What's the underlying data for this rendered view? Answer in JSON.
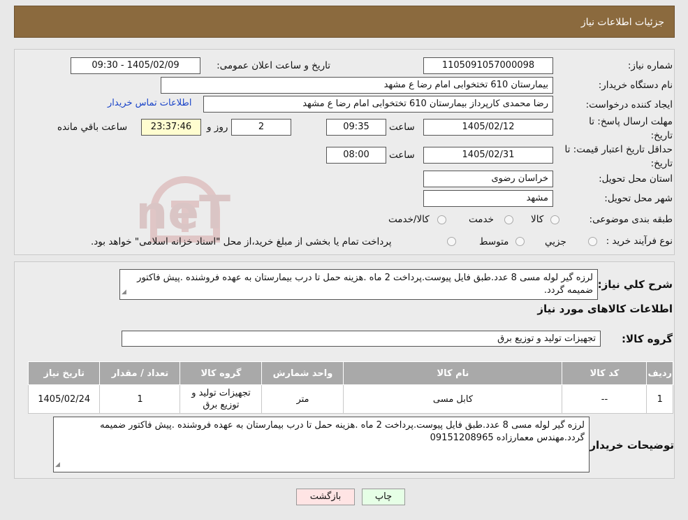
{
  "header": {
    "title": "جزئیات اطلاعات نیاز"
  },
  "form": {
    "need_number_label": "شماره نیاز:",
    "need_number": "1105091057000098",
    "announce_label": "تاریخ و ساعت اعلان عمومی:",
    "announce_value": "1405/02/09 - 09:30",
    "buyer_org_label": "نام دستگاه خریدار:",
    "buyer_org": "بیمارستان 610 تختخوابی امام رضا ع  مشهد",
    "creator_label": "ایجاد کننده درخواست:",
    "creator": "رضا محمدی کارپرداز بیمارستان 610 تختخوابی امام رضا ع  مشهد",
    "contact_link": "اطلاعات تماس خریدار",
    "reply_deadline_label": "مهلت ارسال پاسخ: تا تاریخ:",
    "reply_date": "1405/02/12",
    "time_label": "ساعت",
    "reply_time": "09:35",
    "days_value": "2",
    "days_label": "روز و",
    "remaining_time": "23:37:46",
    "remaining_label": "ساعت باقي مانده",
    "validity_label": "حداقل تاریخ اعتبار قیمت: تا تاریخ:",
    "validity_date": "1405/02/31",
    "validity_time": "08:00",
    "province_label": "استان محل تحویل:",
    "province": "خراسان رضوی",
    "city_label": "شهر محل تحویل:",
    "city": "مشهد",
    "category_label": "طبقه بندی موضوعی:",
    "category_options": [
      "کالا",
      "خدمت",
      "کالا/خدمت"
    ],
    "process_label": "نوع فرآیند خرید :",
    "process_options": [
      "جزيي",
      "متوسط"
    ],
    "process_note": "پرداخت تمام یا بخشی از مبلغ خرید،از محل \"اسناد خزانه اسلامی\" خواهد بود."
  },
  "summary": {
    "label": "شرح کلي نياز:",
    "text": "لرزه گیر لوله مسی 8 عدد.طبق فایل پیوست.پرداخت 2 ماه .هزینه حمل تا درب بیمارستان به عهده فروشنده .پیش فاکتور ضمیمه گردد."
  },
  "goods": {
    "section_title": "اطلاعات کالاهای مورد نیاز",
    "group_label": "گروه کالا:",
    "group_value": "تجهیزات تولید و توزیع برق",
    "columns": [
      "رديف",
      "کد کالا",
      "نام کالا",
      "واحد شمارش",
      "گروه کالا",
      "تعداد / مقدار",
      "تاریخ نیاز"
    ],
    "rows": [
      {
        "row": "1",
        "code": "--",
        "name": "کابل مسی",
        "unit": "متر",
        "group": "تجهیزات تولید و توزیع برق",
        "qty": "1",
        "date": "1405/02/24"
      }
    ]
  },
  "buyer_notes": {
    "label": "توضیحات خریدار:",
    "text": "لرزه گیر لوله مسی 8 عدد.طبق فایل پیوست.پرداخت 2 ماه .هزینه حمل تا درب بیمارستان به عهده فروشنده .پیش فاکتور ضمیمه گردد.مهندس معمارزاده 09151208965"
  },
  "buttons": {
    "print": "چاپ",
    "back": "بازگشت"
  },
  "watermark": {
    "text": "AriaTender.neT"
  },
  "colors": {
    "header_bg": "#8b6a3e",
    "link": "#1a44c8",
    "remaining_bg": "#fffdd0"
  }
}
